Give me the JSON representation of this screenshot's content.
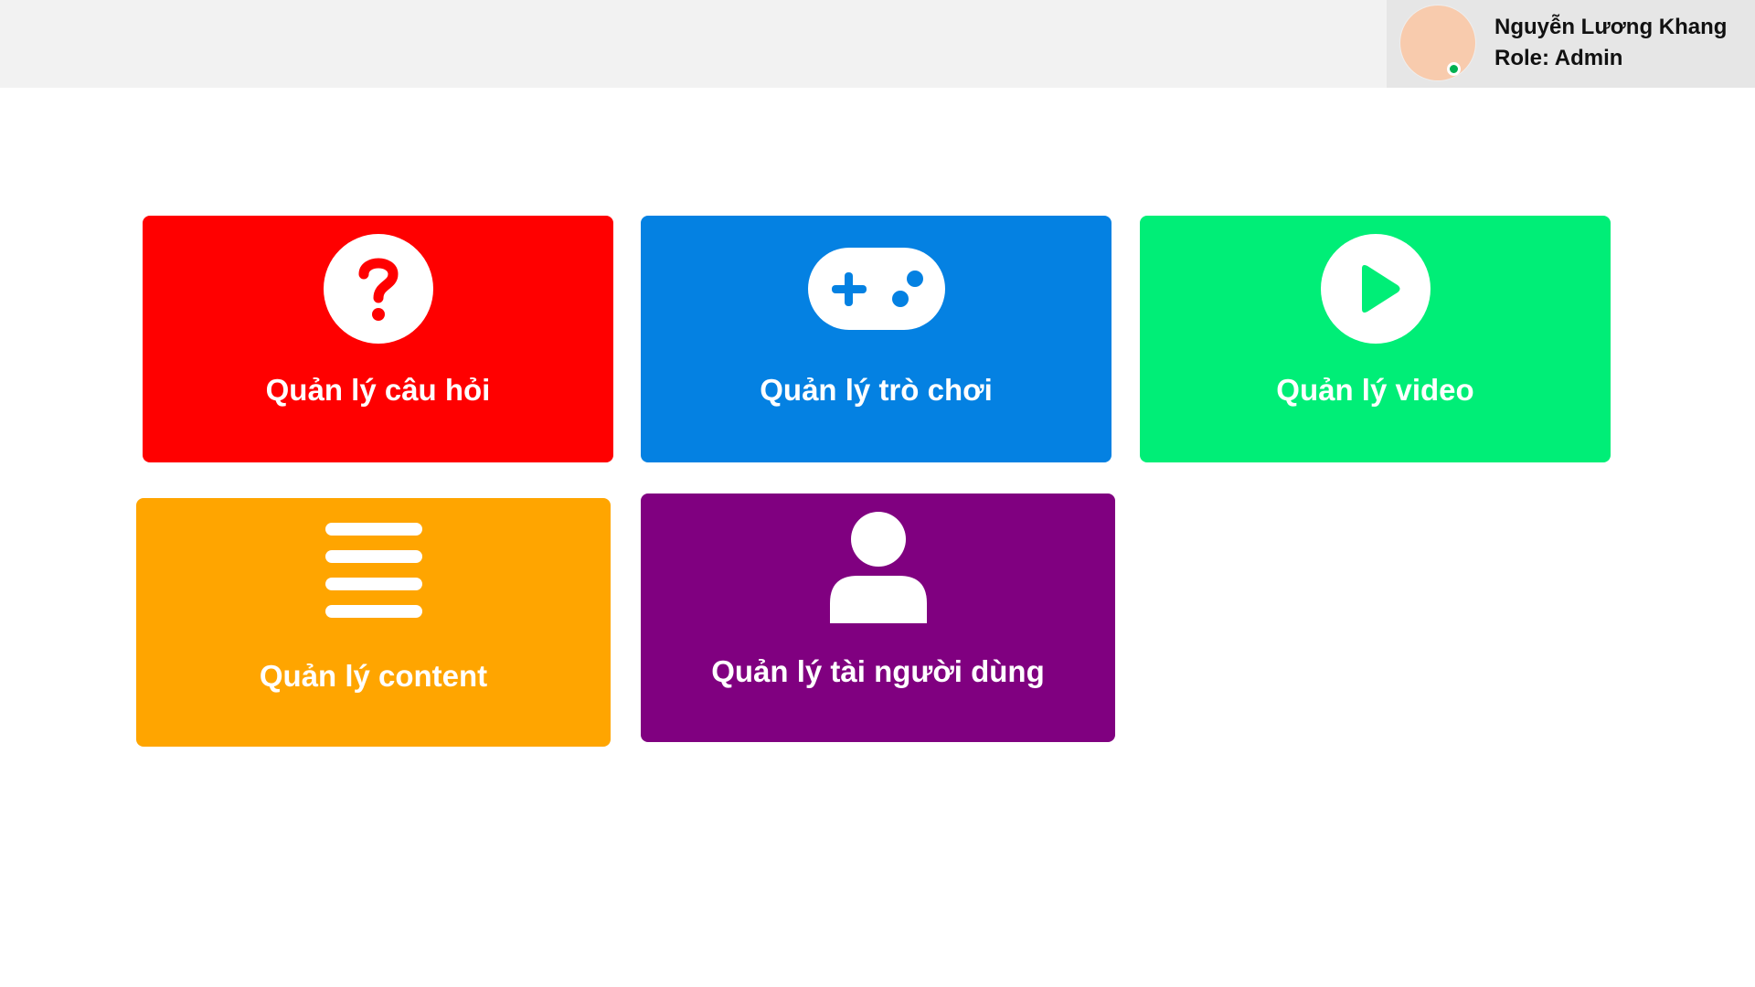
{
  "user": {
    "name": "Nguyễn Lương Khang",
    "role": "Role: Admin",
    "online": true
  },
  "cards": [
    {
      "id": "questions",
      "label": "Quản lý câu hỏi",
      "color": "#ff0000",
      "icon": "question-circle-icon"
    },
    {
      "id": "games",
      "label": "Quản lý trò chơi",
      "color": "#0481e2",
      "icon": "gamepad-icon"
    },
    {
      "id": "video",
      "label": "Quản lý video",
      "color": "#00ee77",
      "icon": "play-circle-icon"
    },
    {
      "id": "content",
      "label": "Quản lý content",
      "color": "#ffa500",
      "icon": "list-lines-icon"
    },
    {
      "id": "users",
      "label": "Quản lý tài người dùng",
      "color": "#800080",
      "icon": "user-icon"
    }
  ]
}
